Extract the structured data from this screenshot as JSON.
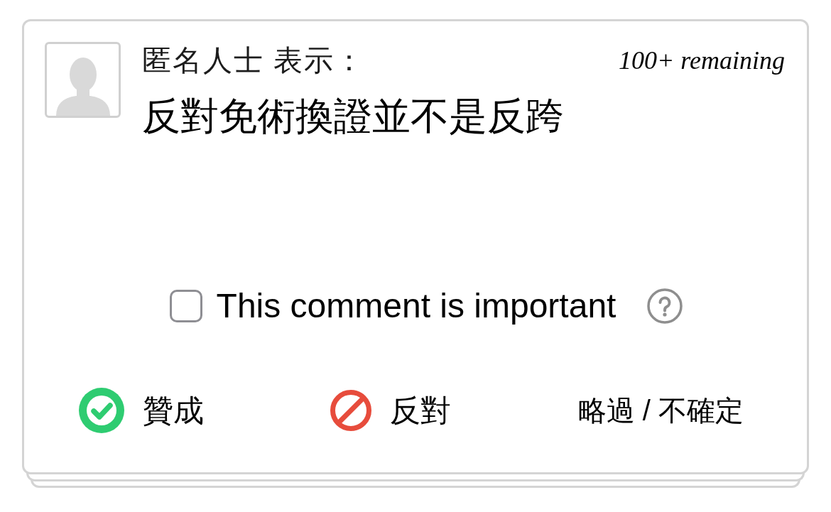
{
  "card": {
    "author": "匿名人士 表示：",
    "remaining": "100+ remaining",
    "comment": "反對免術換證並不是反跨",
    "important": {
      "label": "This comment is important",
      "checked": false
    },
    "votes": [
      {
        "kind": "agree",
        "label": "贊成"
      },
      {
        "kind": "disagree",
        "label": "反對"
      },
      {
        "kind": "pass",
        "label": "略過 / 不確定"
      }
    ]
  }
}
